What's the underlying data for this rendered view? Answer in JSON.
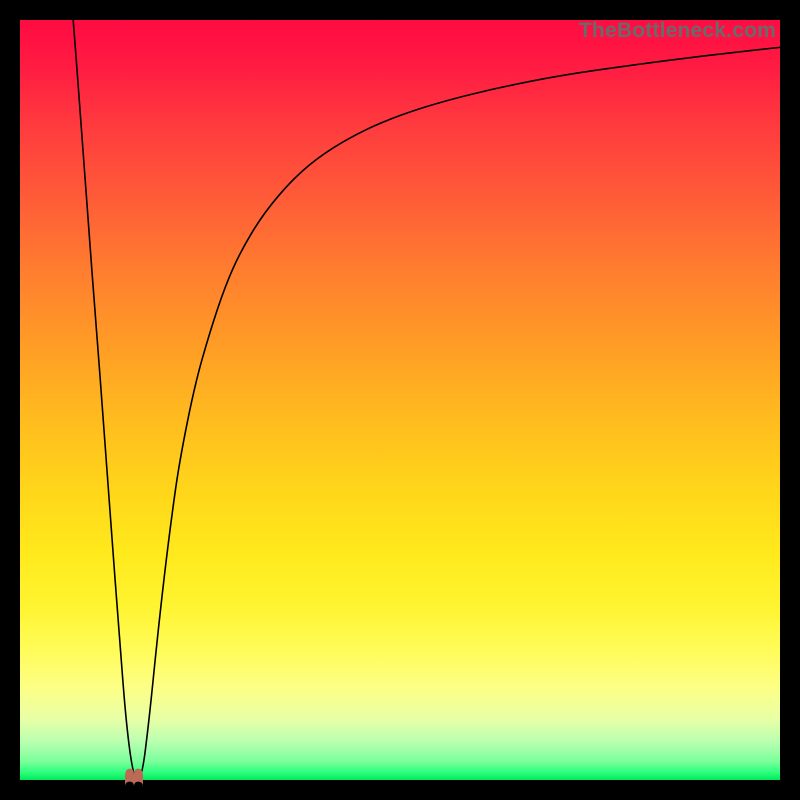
{
  "watermark": "TheBottleneck.com",
  "colors": {
    "frame_bg": "#000000",
    "curve": "#000000",
    "marker": "#bb6a55",
    "gradient_stops": [
      "#ff0b42",
      "#ff1b42",
      "#ff3b3e",
      "#ff5a38",
      "#ff7a30",
      "#ff9a26",
      "#ffba1f",
      "#ffd61a",
      "#ffe91c",
      "#fff430",
      "#fffc5a",
      "#fcff86",
      "#e8ffa6",
      "#b8ffb0",
      "#7cff9c",
      "#2cff7c",
      "#00e85a"
    ]
  },
  "chart_data": {
    "type": "line",
    "title": "",
    "xlabel": "",
    "ylabel": "",
    "xlim": [
      0,
      100
    ],
    "ylim": [
      0,
      100
    ],
    "series": [
      {
        "name": "bottleneck-curve",
        "x": [
          7,
          8,
          9,
          10,
          11,
          12,
          13,
          14,
          15,
          16,
          17,
          18,
          19,
          20,
          21,
          23,
          25,
          27,
          29,
          32,
          36,
          40,
          45,
          50,
          56,
          63,
          71,
          80,
          90,
          100
        ],
        "y": [
          100,
          87,
          73,
          60,
          47,
          33,
          20,
          7,
          0,
          0,
          8,
          18,
          27,
          35,
          42,
          52,
          59,
          65,
          69.5,
          74.5,
          79.2,
          82.5,
          85.4,
          87.5,
          89.4,
          91.1,
          92.7,
          94.0,
          95.3,
          96.4
        ]
      }
    ],
    "notes": "V-shaped bottleneck curve. Minimum (0) near x≈15. Left branch rises steeply to 100 at left edge; right branch rises asymptotically toward ~96 at right edge. Background gradient maps y: red (top, high) → yellow (middle) → green (bottom, low).",
    "marker": {
      "x": 15,
      "y": 0,
      "name": "optimal-point"
    }
  }
}
